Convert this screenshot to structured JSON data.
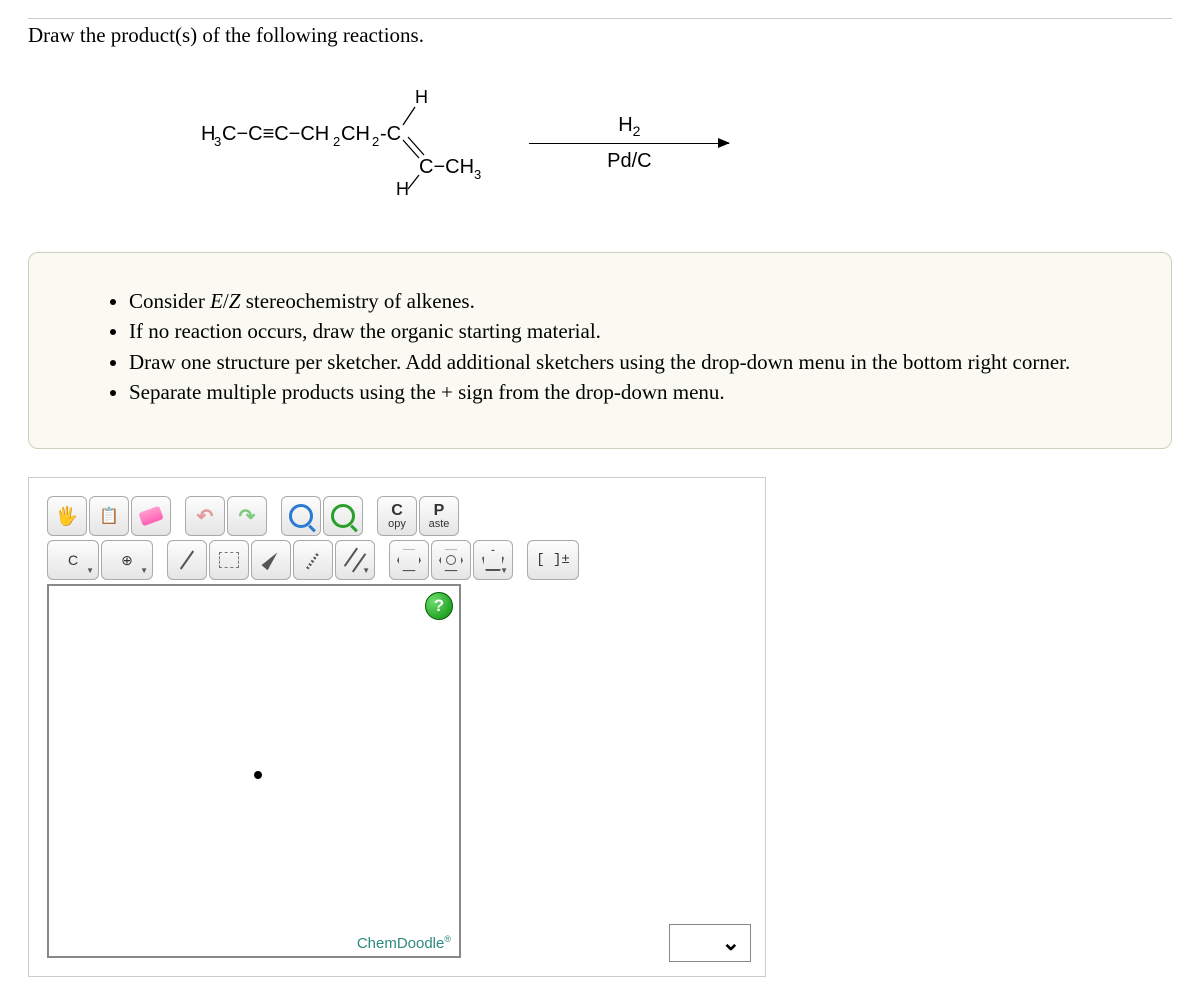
{
  "prompt": "Draw the product(s) of the following reactions.",
  "reaction": {
    "reactant_html": "H₃C−C≡C−CH₂CH₂−C structure with H, C−CH₃, H substituents on a double-bonded carbon",
    "reagent_top": "H₂",
    "reagent_bottom": "Pd/C"
  },
  "instructions": [
    "Consider E/Z stereochemistry of alkenes.",
    "If no reaction occurs, draw the organic starting material.",
    "Draw one structure per sketcher. Add additional sketchers using the drop-down menu in the bottom right corner.",
    "Separate multiple products using the + sign from the drop-down menu."
  ],
  "toolbar": {
    "hand": "✋",
    "doc": "📄",
    "undo": "↶",
    "redo": "↷",
    "copy_big": "C",
    "copy_small": "opy",
    "paste_big": "P",
    "paste_small": "aste",
    "element_label": "C",
    "add_label": "⊕",
    "charge_label": "[ ]±",
    "help": "?"
  },
  "brand": "ChemDoodle",
  "brand_mark": "®"
}
